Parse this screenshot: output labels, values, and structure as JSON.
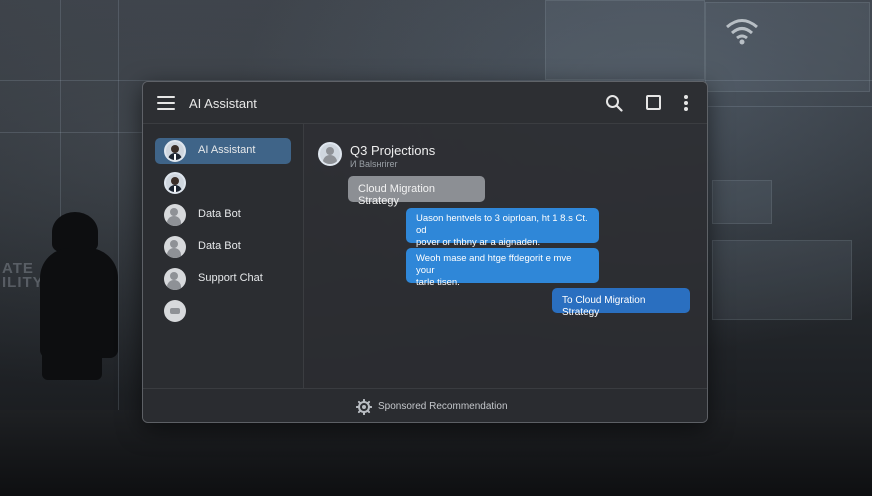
{
  "app": {
    "title": "AI Assistant"
  },
  "toolbar": {
    "menu_icon": "hamburger-menu-icon",
    "search_icon": "search-icon",
    "window_icon": "square-window-icon",
    "more_icon": "vertical-dots-icon"
  },
  "sidebar": {
    "items": [
      {
        "label": "AI Assistant",
        "avatar": "photo",
        "active": true
      },
      {
        "label": "",
        "avatar": "photo",
        "active": false
      },
      {
        "label": "Data Bot",
        "avatar": "generic",
        "active": false
      },
      {
        "label": "Data Bot",
        "avatar": "generic",
        "active": false
      },
      {
        "label": "Support Chat",
        "avatar": "generic",
        "active": false
      },
      {
        "label": "",
        "avatar": "generic",
        "active": false
      }
    ]
  },
  "chat": {
    "title": "Q3 Projections",
    "subtitle": "И Balsнrirer",
    "messages": [
      {
        "style": "grey",
        "lines": [
          "Cloud Migration Strategy"
        ]
      },
      {
        "style": "blue",
        "lines": [
          "Uason hentvels to 3 oiprloan, ht 1 8.s Ct. od",
          "pover or thbny ar a aignaden."
        ]
      },
      {
        "style": "blue",
        "lines": [
          "Weoh mase and htge ffdegorit e mve your",
          "tarle tisen."
        ]
      },
      {
        "style": "blue-dark",
        "lines": [
          "To Cloud Migration Strategy"
        ]
      }
    ]
  },
  "footer": {
    "icon": "gear-icon",
    "label": "Sponsored Recommendation"
  },
  "background": {
    "text_lines": [
      "ATE",
      "ILITY"
    ]
  },
  "colors": {
    "accent_active": "#3f6488",
    "bubble_grey": "#8c8f94",
    "bubble_blue": "#2f87d8",
    "bubble_blue_dark": "#2a6fc0",
    "window_bg": "#2c2e32"
  }
}
